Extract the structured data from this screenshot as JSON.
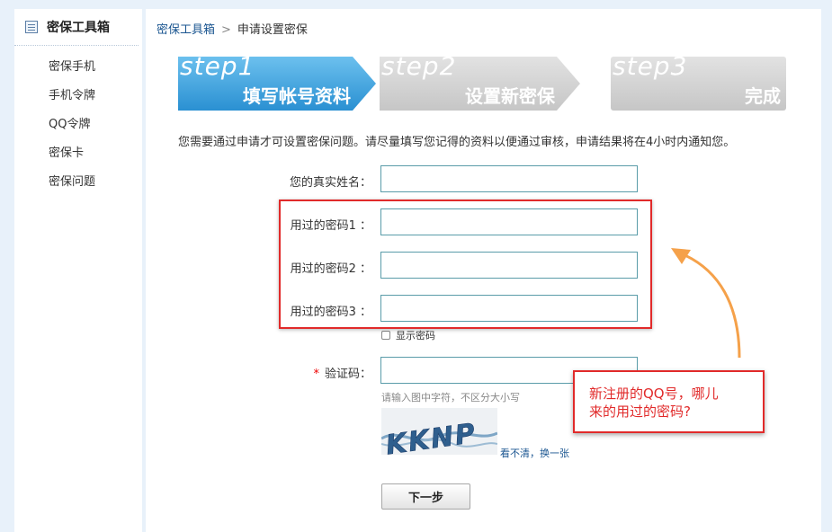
{
  "sidebar": {
    "title": "密保工具箱",
    "title_icon": "notepad-icon",
    "items": [
      {
        "label": "密保手机"
      },
      {
        "label": "手机令牌"
      },
      {
        "label": "QQ令牌"
      },
      {
        "label": "密保卡"
      },
      {
        "label": "密保问题"
      }
    ]
  },
  "breadcrumb": {
    "parent": "密保工具箱",
    "separator": ">",
    "current": "申请设置密保"
  },
  "steps": [
    {
      "top": "step1",
      "bottom": "填写帐号资料",
      "active": true
    },
    {
      "top": "step2",
      "bottom": "设置新密保",
      "active": false
    },
    {
      "top": "step3",
      "bottom": "完成",
      "active": false
    }
  ],
  "notice": "您需要通过申请才可设置密保问题。请尽量填写您记得的资料以便通过审核，申请结果将在4小时内通知您。",
  "form": {
    "real_name_label": "您的真实姓名：",
    "password1_label": "用过的密码1 ：",
    "password2_label": "用过的密码2 ：",
    "password3_label": "用过的密码3 ：",
    "show_password_label": "显示密码",
    "captcha_label": "验证码：",
    "captcha_required_mark": "*",
    "captcha_hint": "请输入图中字符，不区分大小写",
    "captcha_text": "KKNP",
    "refresh_link": "看不清，换一张",
    "submit_label": "下一步"
  },
  "annotation": {
    "note_line1": "新注册的QQ号，哪儿",
    "note_line2": "来的用过的密码?"
  },
  "colors": {
    "active_step": "#3aa0dc",
    "inactive_step": "#d4d4d4",
    "annotation_red": "#e12a2a",
    "arrow_orange": "#f5a14a",
    "link_blue": "#1a5590"
  }
}
